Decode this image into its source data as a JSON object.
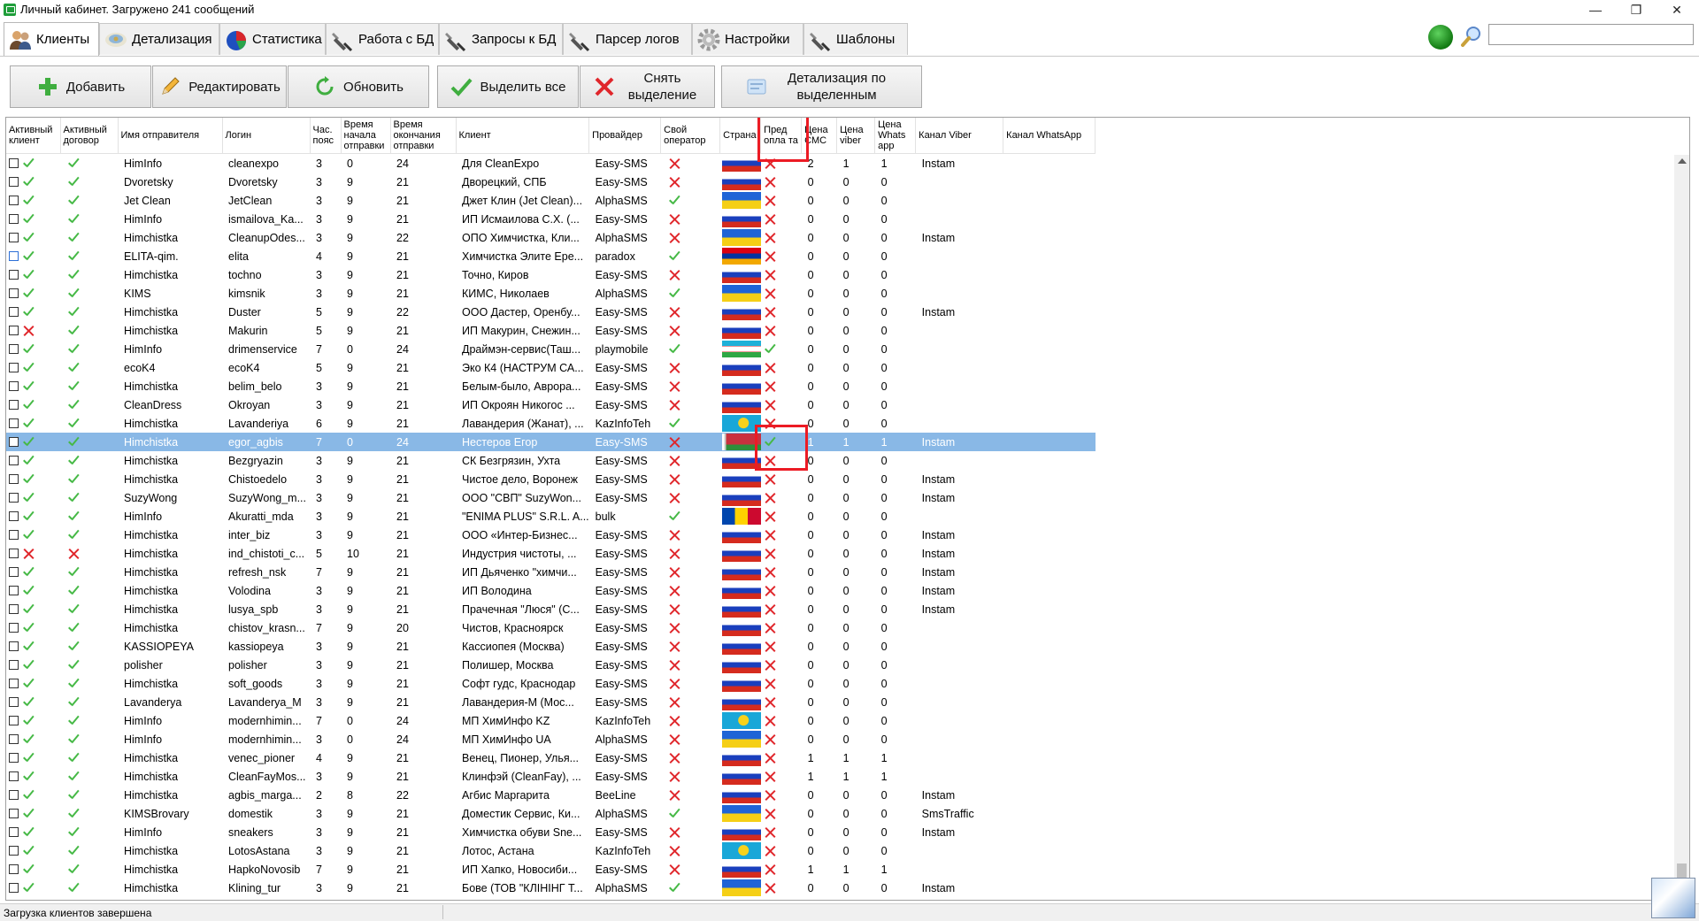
{
  "window": {
    "title": "Личный кабинет. Загружено 241 сообщений",
    "minimize": "—",
    "maximize": "❐",
    "close": "✕"
  },
  "tabs": [
    {
      "label": "Клиенты",
      "icon": "users-icon",
      "active": true
    },
    {
      "label": "Детализация",
      "icon": "detail-icon"
    },
    {
      "label": "Статистика",
      "icon": "pie-chart-icon"
    },
    {
      "label": "Работа с БД",
      "icon": "tools-icon"
    },
    {
      "label": "Запросы к БД",
      "icon": "tools-icon"
    },
    {
      "label": "Парсер логов",
      "icon": "tools-icon"
    },
    {
      "label": "Настройки",
      "icon": "gear-icon"
    },
    {
      "label": "Шаблоны",
      "icon": "tools-icon"
    }
  ],
  "search": {
    "value": "",
    "placeholder": ""
  },
  "toolbar": {
    "add": "Добавить",
    "edit": "Редактировать",
    "refresh": "Обновить",
    "select_all": "Выделить все",
    "deselect": "Снять выделение",
    "detail_selected": "Детализация по выделенным"
  },
  "columns": [
    "Активный клиент",
    "Активный договор",
    "Имя отправителя",
    "Логин",
    "Час. пояс",
    "Время начала отправки",
    "Время окончания отправки",
    "Клиент",
    "Провайдер",
    "Свой оператор",
    "Страна",
    "Пред опла та",
    "Цена СМС",
    "Цена viber",
    "Цена Whats app",
    "Канал Viber",
    "Канал WhatsApp"
  ],
  "rows": [
    [
      "0",
      "1",
      "1",
      "HimInfo",
      "cleanexpo",
      "3",
      "0",
      "24",
      "Для CleanExpo",
      "Easy-SMS",
      "0",
      "ru",
      "0",
      "2",
      "1",
      "1",
      "Instam",
      ""
    ],
    [
      "0",
      "1",
      "1",
      "Dvoretsky",
      "Dvoretsky",
      "3",
      "9",
      "21",
      "Дворецкий, СПБ",
      "Easy-SMS",
      "0",
      "ru",
      "0",
      "0",
      "0",
      "0",
      "",
      ""
    ],
    [
      "0",
      "1",
      "1",
      "Jet Clean",
      "JetClean",
      "3",
      "9",
      "21",
      "Джет Клин (Jet Clean)...",
      "AlphaSMS",
      "1",
      "ua",
      "0",
      "0",
      "0",
      "0",
      "",
      ""
    ],
    [
      "0",
      "1",
      "1",
      "HimInfo",
      "ismailova_Ka...",
      "3",
      "9",
      "21",
      "ИП Исмаилова С.Х. (...",
      "Easy-SMS",
      "0",
      "ru",
      "0",
      "0",
      "0",
      "0",
      "",
      ""
    ],
    [
      "0",
      "1",
      "1",
      "Himchistka",
      "CleanupOdes...",
      "3",
      "9",
      "22",
      "ОПО Химчистка, Кли...",
      "AlphaSMS",
      "0",
      "ua",
      "0",
      "0",
      "0",
      "0",
      "Instam",
      ""
    ],
    [
      "2",
      "1",
      "1",
      "ELITA-qim.",
      "elita",
      "4",
      "9",
      "21",
      "Химчистка Элите Ере...",
      "paradox",
      "1",
      "am",
      "0",
      "0",
      "0",
      "0",
      "",
      ""
    ],
    [
      "0",
      "1",
      "1",
      "Himchistka",
      "tochno",
      "3",
      "9",
      "21",
      "Точно, Киров",
      "Easy-SMS",
      "0",
      "ru",
      "0",
      "0",
      "0",
      "0",
      "",
      ""
    ],
    [
      "0",
      "1",
      "1",
      "KIMS",
      "kimsnik",
      "3",
      "9",
      "21",
      "КИМС, Николаев",
      "AlphaSMS",
      "1",
      "ua",
      "0",
      "0",
      "0",
      "0",
      "",
      ""
    ],
    [
      "0",
      "1",
      "1",
      "Himchistka",
      "Duster",
      "5",
      "9",
      "22",
      "ООО Дастер, Оренбу...",
      "Easy-SMS",
      "0",
      "ru",
      "0",
      "0",
      "0",
      "0",
      "Instam",
      ""
    ],
    [
      "0",
      "0",
      "1",
      "Himchistka",
      "Makurin",
      "5",
      "9",
      "21",
      "ИП Макурин, Снежин...",
      "Easy-SMS",
      "0",
      "ru",
      "0",
      "0",
      "0",
      "0",
      "",
      ""
    ],
    [
      "0",
      "1",
      "1",
      "HimInfo",
      "drimenservice",
      "7",
      "0",
      "24",
      "Драймэн-сервис(Таш...",
      "playmobile",
      "1",
      "uz",
      "1",
      "0",
      "0",
      "0",
      "",
      ""
    ],
    [
      "0",
      "1",
      "1",
      "ecoK4",
      "ecoK4",
      "5",
      "9",
      "21",
      "Эко К4 (НАСТРУМ СА...",
      "Easy-SMS",
      "0",
      "ru",
      "0",
      "0",
      "0",
      "0",
      "",
      ""
    ],
    [
      "0",
      "1",
      "1",
      "Himchistka",
      "belim_belo",
      "3",
      "9",
      "21",
      "Белым-было, Аврора...",
      "Easy-SMS",
      "0",
      "ru",
      "0",
      "0",
      "0",
      "0",
      "",
      ""
    ],
    [
      "0",
      "1",
      "1",
      "CleanDress",
      "Okroyan",
      "3",
      "9",
      "21",
      "ИП Окроян Никогос ...",
      "Easy-SMS",
      "0",
      "ru",
      "0",
      "0",
      "0",
      "0",
      "",
      ""
    ],
    [
      "0",
      "1",
      "1",
      "Himchistka",
      "Lavanderiya",
      "6",
      "9",
      "21",
      "Лавандерия (Жанат), ...",
      "KazInfoTeh",
      "1",
      "kz",
      "0",
      "0",
      "0",
      "0",
      "",
      ""
    ],
    [
      "0",
      "1",
      "1",
      "Himchistka",
      "egor_agbis",
      "7",
      "0",
      "24",
      "Нестеров Егор",
      "Easy-SMS",
      "0",
      "by",
      "1",
      "1",
      "1",
      "1",
      "Instam",
      ""
    ],
    [
      "0",
      "1",
      "1",
      "Himchistka",
      "Bezgryazin",
      "3",
      "9",
      "21",
      "СК Безгрязин, Ухта",
      "Easy-SMS",
      "0",
      "ru",
      "0",
      "0",
      "0",
      "0",
      "",
      ""
    ],
    [
      "0",
      "1",
      "1",
      "Himchistka",
      "Chistoedelo",
      "3",
      "9",
      "21",
      "Чистое дело, Воронеж",
      "Easy-SMS",
      "0",
      "ru",
      "0",
      "0",
      "0",
      "0",
      "Instam",
      ""
    ],
    [
      "0",
      "1",
      "1",
      "SuzyWong",
      "SuzyWong_m...",
      "3",
      "9",
      "21",
      "ООО \"СВП\" SuzyWon...",
      "Easy-SMS",
      "0",
      "ru",
      "0",
      "0",
      "0",
      "0",
      "Instam",
      ""
    ],
    [
      "0",
      "1",
      "1",
      "HimInfo",
      "Akuratti_mda",
      "3",
      "9",
      "21",
      "\"ENIMA PLUS\" S.R.L. A...",
      "bulk",
      "1",
      "md",
      "0",
      "0",
      "0",
      "0",
      "",
      ""
    ],
    [
      "0",
      "1",
      "1",
      "Himchistka",
      "inter_biz",
      "3",
      "9",
      "21",
      "ООО «Интер-Бизнес...",
      "Easy-SMS",
      "0",
      "ru",
      "0",
      "0",
      "0",
      "0",
      "Instam",
      ""
    ],
    [
      "0",
      "0",
      "0",
      "Himchistka",
      "ind_chistoti_c...",
      "5",
      "10",
      "21",
      "Индустрия чистоты, ...",
      "Easy-SMS",
      "0",
      "ru",
      "0",
      "0",
      "0",
      "0",
      "Instam",
      ""
    ],
    [
      "0",
      "1",
      "1",
      "Himchistka",
      "refresh_nsk",
      "7",
      "9",
      "21",
      "ИП Дьяченко \"химчи...",
      "Easy-SMS",
      "0",
      "ru",
      "0",
      "0",
      "0",
      "0",
      "Instam",
      ""
    ],
    [
      "0",
      "1",
      "1",
      "Himchistka",
      "Volodina",
      "3",
      "9",
      "21",
      "ИП Володина",
      "Easy-SMS",
      "0",
      "ru",
      "0",
      "0",
      "0",
      "0",
      "Instam",
      ""
    ],
    [
      "0",
      "1",
      "1",
      "Himchistka",
      "lusya_spb",
      "3",
      "9",
      "21",
      "Прачечная \"Люся\" (С...",
      "Easy-SMS",
      "0",
      "ru",
      "0",
      "0",
      "0",
      "0",
      "Instam",
      ""
    ],
    [
      "0",
      "1",
      "1",
      "Himchistka",
      "chistov_krasn...",
      "7",
      "9",
      "20",
      "Чистов, Красноярск",
      "Easy-SMS",
      "0",
      "ru",
      "0",
      "0",
      "0",
      "0",
      "",
      ""
    ],
    [
      "0",
      "1",
      "1",
      "KASSIOPEYA",
      "kassiopeya",
      "3",
      "9",
      "21",
      "Кассиопея (Москва)",
      "Easy-SMS",
      "0",
      "ru",
      "0",
      "0",
      "0",
      "0",
      "",
      ""
    ],
    [
      "0",
      "1",
      "1",
      "polisher",
      "polisher",
      "3",
      "9",
      "21",
      "Полишер, Москва",
      "Easy-SMS",
      "0",
      "ru",
      "0",
      "0",
      "0",
      "0",
      "",
      ""
    ],
    [
      "0",
      "1",
      "1",
      "Himchistka",
      "soft_goods",
      "3",
      "9",
      "21",
      "Софт гудс, Краснодар",
      "Easy-SMS",
      "0",
      "ru",
      "0",
      "0",
      "0",
      "0",
      "",
      ""
    ],
    [
      "0",
      "1",
      "1",
      "Lavanderya",
      "Lavanderya_M",
      "3",
      "9",
      "21",
      "Лавандерия-М (Мос...",
      "Easy-SMS",
      "0",
      "ru",
      "0",
      "0",
      "0",
      "0",
      "",
      ""
    ],
    [
      "0",
      "1",
      "1",
      "HimInfo",
      "modernhimin...",
      "7",
      "0",
      "24",
      "МП ХимИнфо KZ",
      "KazInfoTeh",
      "0",
      "kz",
      "0",
      "0",
      "0",
      "0",
      "",
      ""
    ],
    [
      "0",
      "1",
      "1",
      "HimInfo",
      "modernhimin...",
      "3",
      "0",
      "24",
      "МП ХимИнфо UA",
      "AlphaSMS",
      "0",
      "ua",
      "0",
      "0",
      "0",
      "0",
      "",
      ""
    ],
    [
      "0",
      "1",
      "1",
      "Himchistka",
      "venec_pioner",
      "4",
      "9",
      "21",
      "Венец, Пионер, Улья...",
      "Easy-SMS",
      "0",
      "ru",
      "0",
      "1",
      "1",
      "1",
      "",
      ""
    ],
    [
      "0",
      "1",
      "1",
      "Himchistka",
      "CleanFayMos...",
      "3",
      "9",
      "21",
      "Клинфэй (CleanFay), ...",
      "Easy-SMS",
      "0",
      "ru",
      "0",
      "1",
      "1",
      "1",
      "",
      ""
    ],
    [
      "0",
      "1",
      "1",
      "Himchistka",
      "agbis_marga...",
      "2",
      "8",
      "22",
      "Агбис Маргарита",
      "BeeLine",
      "0",
      "ru",
      "0",
      "0",
      "0",
      "0",
      "Instam",
      ""
    ],
    [
      "0",
      "1",
      "1",
      "KIMSBrovary",
      "domestik",
      "3",
      "9",
      "21",
      "Доместик Сервис, Ки...",
      "AlphaSMS",
      "1",
      "ua",
      "0",
      "0",
      "0",
      "0",
      "SmsTraffic",
      ""
    ],
    [
      "0",
      "1",
      "1",
      "HimInfo",
      "sneakers",
      "3",
      "9",
      "21",
      "Химчистка обуви Sne...",
      "Easy-SMS",
      "0",
      "ru",
      "0",
      "0",
      "0",
      "0",
      "Instam",
      ""
    ],
    [
      "0",
      "1",
      "1",
      "Himchistka",
      "LotosAstana",
      "3",
      "9",
      "21",
      "Лотос, Астана",
      "KazInfoTeh",
      "0",
      "kz",
      "0",
      "0",
      "0",
      "0",
      "",
      ""
    ],
    [
      "0",
      "1",
      "1",
      "Himchistka",
      "HapkoNovosib",
      "7",
      "9",
      "21",
      "ИП Хапко, Новосиби...",
      "Easy-SMS",
      "0",
      "ru",
      "0",
      "1",
      "1",
      "1",
      "",
      ""
    ],
    [
      "0",
      "1",
      "1",
      "Himchistka",
      "Klining_tur",
      "3",
      "9",
      "21",
      "Бове (ТОВ \"КЛІНІНГ Т...",
      "AlphaSMS",
      "1",
      "ua",
      "0",
      "0",
      "0",
      "0",
      "Instam",
      ""
    ]
  ],
  "selected_row": 15,
  "status": {
    "text": "Загрузка клиентов завершена"
  },
  "colors": {
    "accent": "#89b8e6",
    "ok": "#46b946",
    "no": "#e0262b",
    "highlight": "#ec1b24"
  }
}
